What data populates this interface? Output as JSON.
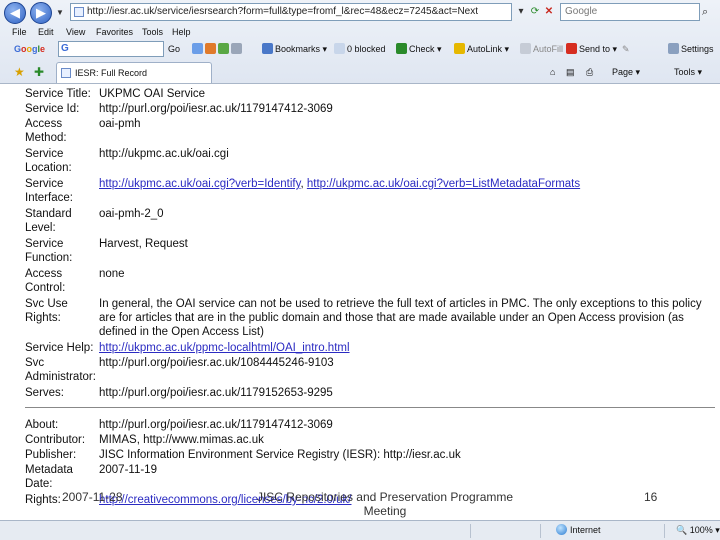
{
  "browser": {
    "address": "http://iesr.ac.uk/service/iesrsearch?form=full&type=fromf_l&rec=48&ecz=7245&act=Next",
    "search_placeholder": "Google"
  },
  "menu": {
    "file": "File",
    "edit": "Edit",
    "view": "View",
    "favorites": "Favorites",
    "tools": "Tools",
    "help": "Help"
  },
  "google_toolbar": {
    "logo": "Google",
    "go": "Go",
    "bookmarks": "Bookmarks",
    "blocked": "0 blocked",
    "check": "Check",
    "autolink": "AutoLink",
    "autofill": "AutoFill",
    "send_to": "Send to",
    "settings": "Settings"
  },
  "tab": {
    "title": "IESR: Full Record"
  },
  "command_bar": {
    "page": "Page",
    "tools": "Tools"
  },
  "record": {
    "rows": [
      {
        "label": "Service Title:",
        "value": "UKPMC OAI Service"
      },
      {
        "label": "Service Id:",
        "value": "http://purl.org/poi/iesr.ac.uk/1179147412-3069"
      },
      {
        "label": "Access Method:",
        "value": "oai-pmh"
      },
      {
        "label": "Service Location:",
        "value": "http://ukpmc.ac.uk/oai.cgi"
      },
      {
        "label": "Service Interface:",
        "link1": "http://ukpmc.ac.uk/oai.cgi?verb=Identify",
        "sep": ", ",
        "link2": "http://ukpmc.ac.uk/oai.cgi?verb=ListMetadataFormats"
      },
      {
        "label": "Standard Level:",
        "value": "oai-pmh-2_0"
      },
      {
        "label": "Service Function:",
        "value": "Harvest, Request"
      },
      {
        "label": "Access Control:",
        "value": "none"
      },
      {
        "label": "Svc Use Rights:",
        "value": "In general, the OAI service can not be used to retrieve the full text of articles in PMC. The only exceptions to this policy are for articles that are in the public domain and those that are made available under an Open Access provision (as defined in the Open Access List)"
      },
      {
        "label": "Service Help:",
        "link1": "http://ukpmc.ac.uk/ppmc-localhtml/OAI_intro.html"
      },
      {
        "label": "Svc Administrator:",
        "value": "http://purl.org/poi/iesr.ac.uk/1084445246-9103"
      },
      {
        "label": "Serves:",
        "value": "http://purl.org/poi/iesr.ac.uk/1179152653-9295"
      }
    ],
    "meta": [
      {
        "label": "About:",
        "value": "http://purl.org/poi/iesr.ac.uk/1179147412-3069"
      },
      {
        "label": "Contributor:",
        "value": "MIMAS, http://www.mimas.ac.uk"
      },
      {
        "label": "Publisher:",
        "value": "JISC Information Environment Service Registry (IESR): http://iesr.ac.uk"
      },
      {
        "label": "Metadata Date:",
        "value": "2007-11-19"
      },
      {
        "label": "Rights:",
        "link1": "http://creativecommons.org/licenses/by-nc/2.0/uk/"
      }
    ]
  },
  "slide_footer": {
    "date": "2007-11-28",
    "title": "JISC Repositories and Preservation Programme Meeting",
    "page": "16"
  },
  "status": {
    "zone": "Internet",
    "zoom": "100%"
  }
}
